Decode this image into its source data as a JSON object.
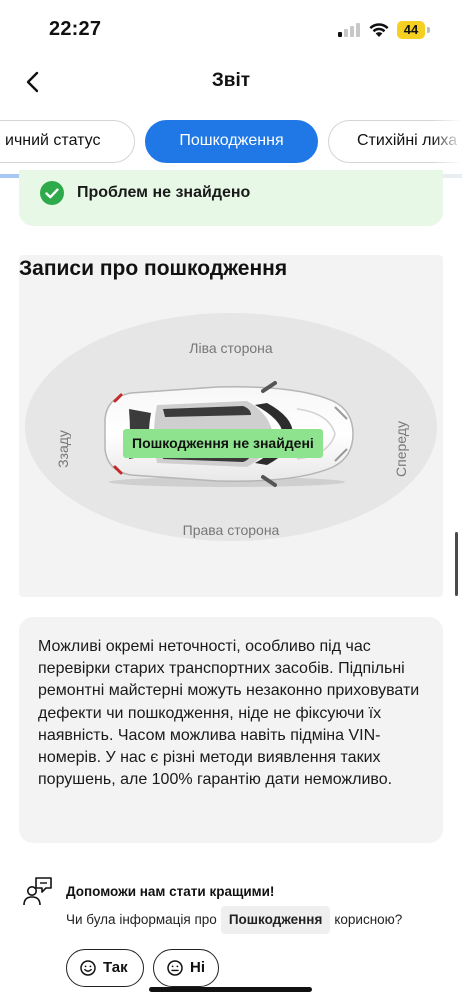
{
  "status_bar": {
    "time": "22:27",
    "battery": "44",
    "battery_color": "#f5d020"
  },
  "nav": {
    "title": "Звіт",
    "back_icon": "chevron-left-icon"
  },
  "tabs": [
    {
      "label": "Історичний статус",
      "visible_label": "ичний статус",
      "active": false
    },
    {
      "label": "Пошкодження",
      "active": true
    },
    {
      "label": "Стихійні лиха",
      "visible_label": "Стихійні лиха",
      "active": false
    }
  ],
  "colors": {
    "accent": "#1f78e5",
    "success_bg": "#e7f8e7",
    "success_icon": "#2eaa4a",
    "tag_green": "#8ee38e"
  },
  "status_banner": {
    "text": "Проблем не знайдено",
    "icon": "check-circle-icon"
  },
  "damage": {
    "title": "Записи про пошкодження",
    "left_side": "Ліва сторона",
    "right_side": "Права сторона",
    "rear": "Ззаду",
    "front": "Спереду",
    "result": "Пошкодження не знайдені"
  },
  "disclaimer": "Можливі окремі неточності, особливо під час перевірки старих транспортних засобів. Підпільні ремонтні майстерні можуть незаконно приховувати дефекти чи пошкодження, ніде не фіксуючи їх наявність. Часом можлива навіть підміна VIN-номерів. У нас є різні методи виявлення таких порушень, але 100% гарантію дати неможливо.",
  "feedback": {
    "title": "Допоможи нам стати кращими!",
    "question_before": "Чи була інформація про",
    "question_topic": "Пошкодження",
    "question_after": "корисною?",
    "yes_label": "Так",
    "no_label": "Ні"
  }
}
